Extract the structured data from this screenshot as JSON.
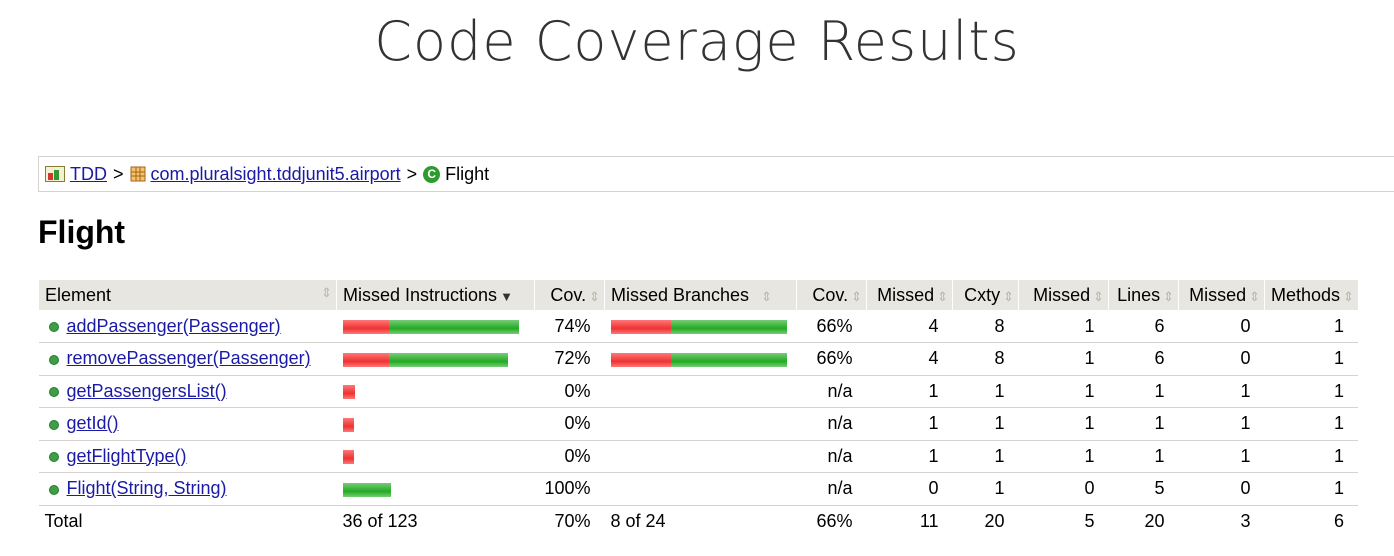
{
  "slide_title": "Code Coverage Results",
  "breadcrumb": {
    "root": "TDD",
    "package": "com.pluralsight.tddjunit5.airport",
    "current": "Flight",
    "separator": ">"
  },
  "heading": "Flight",
  "colors": {
    "missed": "#e33333",
    "covered": "#22aa22",
    "link": "#1a1aa6",
    "header_bg": "#e8e6e0"
  },
  "table": {
    "headers": {
      "element": "Element",
      "missed_instructions": "Missed Instructions",
      "cov_instr": "Cov.",
      "missed_branches": "Missed Branches",
      "cov_branch": "Cov.",
      "missed_cxty": "Missed",
      "cxty": "Cxty",
      "missed_lines": "Missed",
      "lines": "Lines",
      "missed_methods": "Missed",
      "methods": "Methods"
    },
    "rows": [
      {
        "element": "addPassenger(Passenger)",
        "instr_missed_frac": 0.26,
        "instr_bar_scale": 1.0,
        "cov_instr": "74%",
        "branch_missed_frac": 0.34,
        "branch_bar_scale": 1.0,
        "cov_branch": "66%",
        "missed_cxty": "4",
        "cxty": "8",
        "missed_lines": "1",
        "lines": "6",
        "missed_methods": "0",
        "methods": "1"
      },
      {
        "element": "removePassenger(Passenger)",
        "instr_missed_frac": 0.28,
        "instr_bar_scale": 0.94,
        "cov_instr": "72%",
        "branch_missed_frac": 0.34,
        "branch_bar_scale": 1.0,
        "cov_branch": "66%",
        "missed_cxty": "4",
        "cxty": "8",
        "missed_lines": "1",
        "lines": "6",
        "missed_methods": "0",
        "methods": "1"
      },
      {
        "element": "getPassengersList()",
        "instr_missed_frac": 1.0,
        "instr_bar_scale": 0.07,
        "cov_instr": "0%",
        "branch_missed_frac": 0,
        "branch_bar_scale": 0,
        "cov_branch": "n/a",
        "missed_cxty": "1",
        "cxty": "1",
        "missed_lines": "1",
        "lines": "1",
        "missed_methods": "1",
        "methods": "1"
      },
      {
        "element": "getId()",
        "instr_missed_frac": 1.0,
        "instr_bar_scale": 0.06,
        "cov_instr": "0%",
        "branch_missed_frac": 0,
        "branch_bar_scale": 0,
        "cov_branch": "n/a",
        "missed_cxty": "1",
        "cxty": "1",
        "missed_lines": "1",
        "lines": "1",
        "missed_methods": "1",
        "methods": "1"
      },
      {
        "element": "getFlightType()",
        "instr_missed_frac": 1.0,
        "instr_bar_scale": 0.06,
        "cov_instr": "0%",
        "branch_missed_frac": 0,
        "branch_bar_scale": 0,
        "cov_branch": "n/a",
        "missed_cxty": "1",
        "cxty": "1",
        "missed_lines": "1",
        "lines": "1",
        "missed_methods": "1",
        "methods": "1"
      },
      {
        "element": "Flight(String, String)",
        "instr_missed_frac": 0,
        "instr_bar_scale": 0.27,
        "cov_instr": "100%",
        "branch_missed_frac": 0,
        "branch_bar_scale": 0,
        "cov_branch": "n/a",
        "missed_cxty": "0",
        "cxty": "1",
        "missed_lines": "0",
        "lines": "5",
        "missed_methods": "0",
        "methods": "1"
      }
    ],
    "total": {
      "label": "Total",
      "missed_instructions": "36 of 123",
      "cov_instr": "70%",
      "missed_branches": "8 of 24",
      "cov_branch": "66%",
      "missed_cxty": "11",
      "cxty": "20",
      "missed_lines": "5",
      "lines": "20",
      "missed_methods": "3",
      "methods": "6"
    }
  }
}
